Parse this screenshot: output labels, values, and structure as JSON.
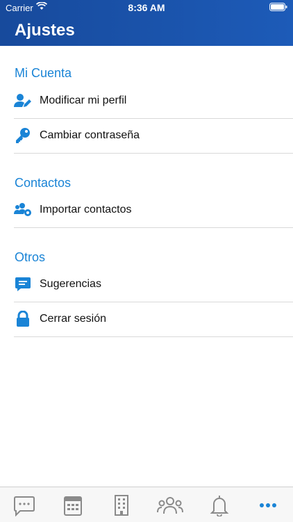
{
  "status_bar": {
    "carrier": "Carrier",
    "time": "8:36 AM"
  },
  "header": {
    "title": "Ajustes"
  },
  "sections": [
    {
      "title": "Mi Cuenta",
      "items": [
        {
          "label": "Modificar mi perfil",
          "icon": "user-edit-icon"
        },
        {
          "label": "Cambiar contraseña",
          "icon": "key-icon"
        }
      ]
    },
    {
      "title": "Contactos",
      "items": [
        {
          "label": "Importar contactos",
          "icon": "users-cog-icon"
        }
      ]
    },
    {
      "title": "Otros",
      "items": [
        {
          "label": "Sugerencias",
          "icon": "comment-icon"
        },
        {
          "label": "Cerrar sesión",
          "icon": "lock-icon"
        }
      ]
    }
  ],
  "tabbar": {
    "tabs": [
      "messages-icon",
      "calendar-icon",
      "building-icon",
      "group-icon",
      "bell-icon",
      "more-icon"
    ],
    "active": "more-icon"
  },
  "colors": {
    "header": "#1a53ad",
    "accent": "#1a84d6",
    "icon_inactive": "#8a8a8a"
  }
}
